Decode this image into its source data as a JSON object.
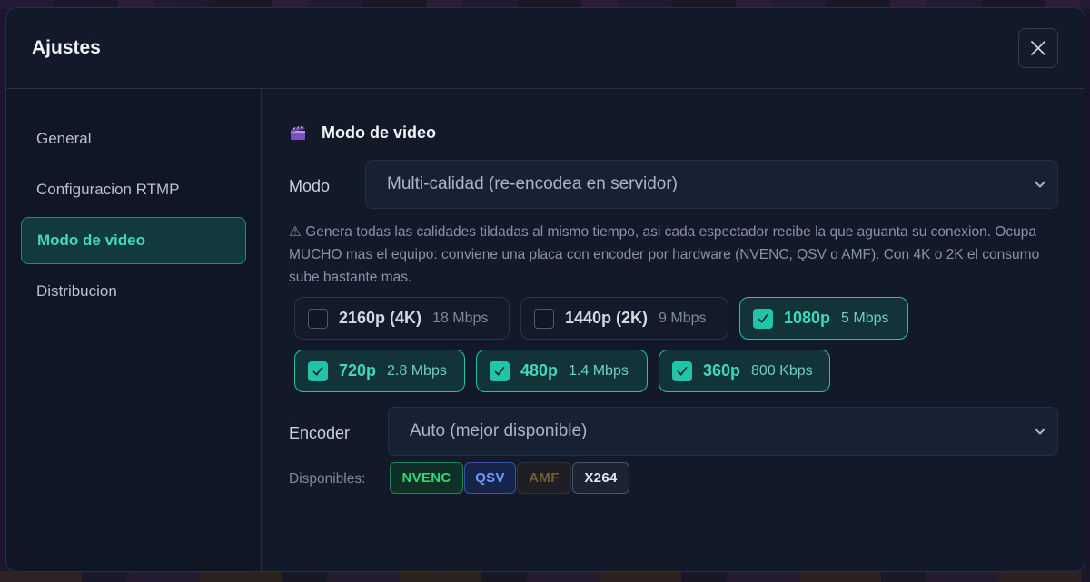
{
  "modal": {
    "title": "Ajustes"
  },
  "sidebar": {
    "items": [
      {
        "label": "General",
        "active": false
      },
      {
        "label": "Configuracion RTMP",
        "active": false
      },
      {
        "label": "Modo de video",
        "active": true
      },
      {
        "label": "Distribucion",
        "active": false
      }
    ]
  },
  "section": {
    "title": "Modo de video",
    "icon": "clapperboard-icon"
  },
  "mode": {
    "label": "Modo",
    "value": "Multi-calidad (re-encodea en servidor)"
  },
  "warning": {
    "text": "⚠ Genera todas las calidades tildadas al mismo tiempo, asi cada espectador recibe la que aguanta su conexion. Ocupa MUCHO mas el equipo: conviene una placa con encoder por hardware (NVENC, QSV o AMF). Con 4K o 2K el consumo sube bastante mas."
  },
  "qualities": [
    {
      "name": "2160p (4K)",
      "rate": "18 Mbps",
      "checked": false
    },
    {
      "name": "1440p (2K)",
      "rate": "9 Mbps",
      "checked": false
    },
    {
      "name": "1080p",
      "rate": "5 Mbps",
      "checked": true
    },
    {
      "name": "720p",
      "rate": "2.8 Mbps",
      "checked": true
    },
    {
      "name": "480p",
      "rate": "1.4 Mbps",
      "checked": true
    },
    {
      "name": "360p",
      "rate": "800 Kbps",
      "checked": true
    }
  ],
  "encoder": {
    "label": "Encoder",
    "value": "Auto (mejor disponible)"
  },
  "available": {
    "label": "Disponibles:",
    "badges": [
      {
        "label": "NVENC",
        "state": "available",
        "color": "#35d67a"
      },
      {
        "label": "QSV",
        "state": "available",
        "color": "#6e9bff"
      },
      {
        "label": "AMF",
        "state": "unavailable",
        "color": "#6f5f2c"
      },
      {
        "label": "X264",
        "state": "available",
        "color": "#e4e8ef"
      }
    ]
  },
  "colors": {
    "accent": "#21c4a8",
    "accent_text": "#3fd8bd",
    "panel": "#121a2a"
  }
}
